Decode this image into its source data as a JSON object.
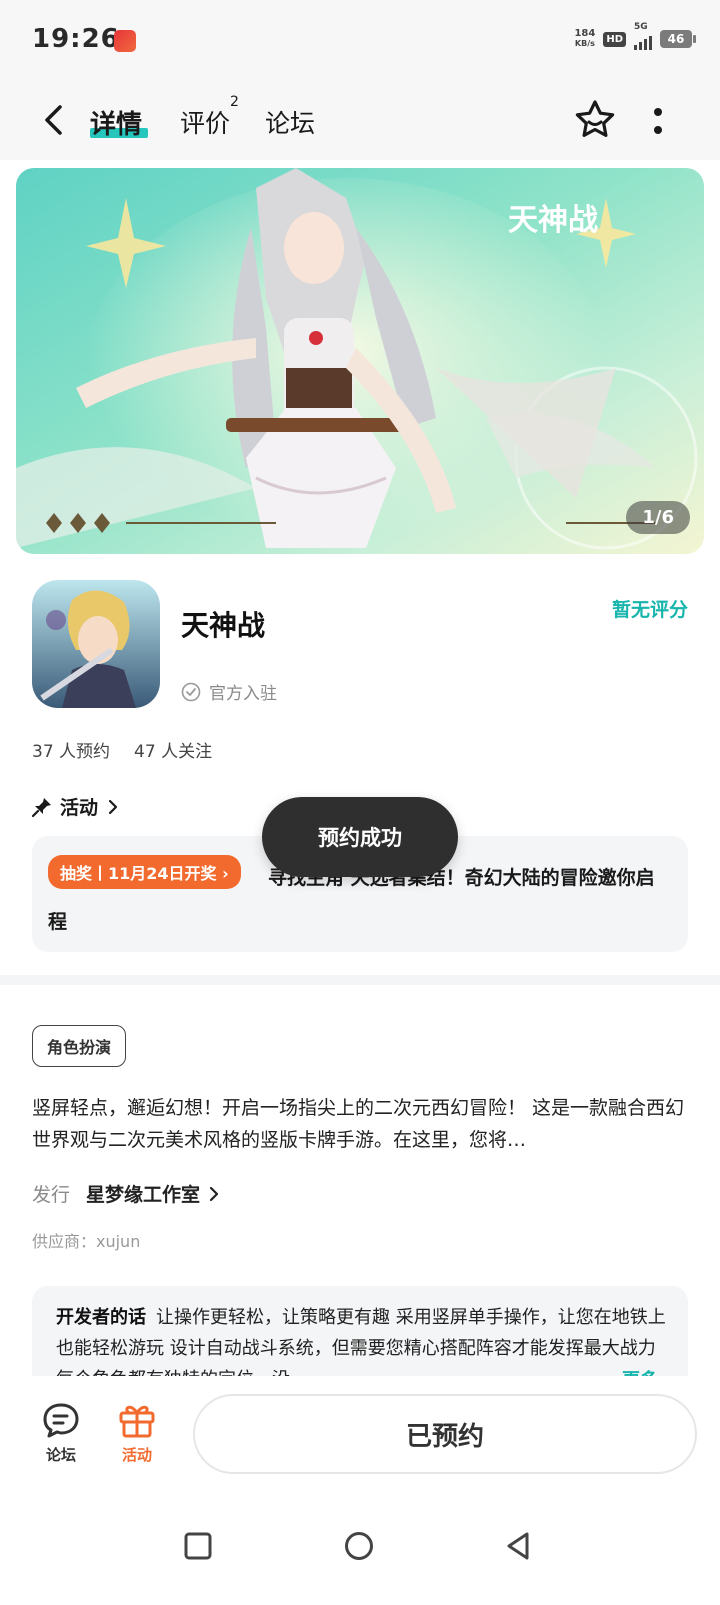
{
  "status_bar": {
    "time": "19:26",
    "net_speed_value": "184",
    "net_speed_unit": "KB/s",
    "hd": "HD",
    "network": "5G",
    "battery": "46"
  },
  "nav": {
    "tabs": [
      {
        "label": "详情",
        "active": true
      },
      {
        "label": "评价",
        "badge": "2"
      },
      {
        "label": "论坛"
      }
    ]
  },
  "banner": {
    "watermark_title": "天神战",
    "counter": "1/6"
  },
  "app": {
    "name": "天神战",
    "official": "官方入驻",
    "rating": "暂无评分",
    "reservations": "37 人预约",
    "followers": "47 人关注"
  },
  "activity": {
    "heading": "活动",
    "tag": "抽奖丨11月24日开奖",
    "text": "寻找主角  天选者集结！奇幻大陆的冒险邀你启程"
  },
  "toast": "预约成功",
  "details": {
    "genre": "角色扮演",
    "description": "竖屏轻点，邂逅幻想！开启一场指尖上的二次元西幻冒险！ 这是一款融合西幻世界观与二次元美术风格的竖版卡牌手游。在这里，您将…",
    "publisher_label": "发行",
    "publisher_name": "星梦缘工作室",
    "supplier": "供应商：xujun",
    "dev_label": "开发者的话",
    "dev_text": "让操作更轻松，让策略更有趣 采用竖屏单手操作，让您在地铁上也能轻松游玩 设计自动战斗系统，但需要您精心搭配阵容才能发挥最大战力 每个角色都有独特的定位，没",
    "dev_more": "更多"
  },
  "bottom": {
    "forum": "论坛",
    "activity": "活动",
    "reserved": "已预约"
  },
  "colors": {
    "accent": "#26c6bd",
    "rating": "#17b5ac",
    "orange": "#f26a2e",
    "toast_bg": "#2f2f2f"
  }
}
